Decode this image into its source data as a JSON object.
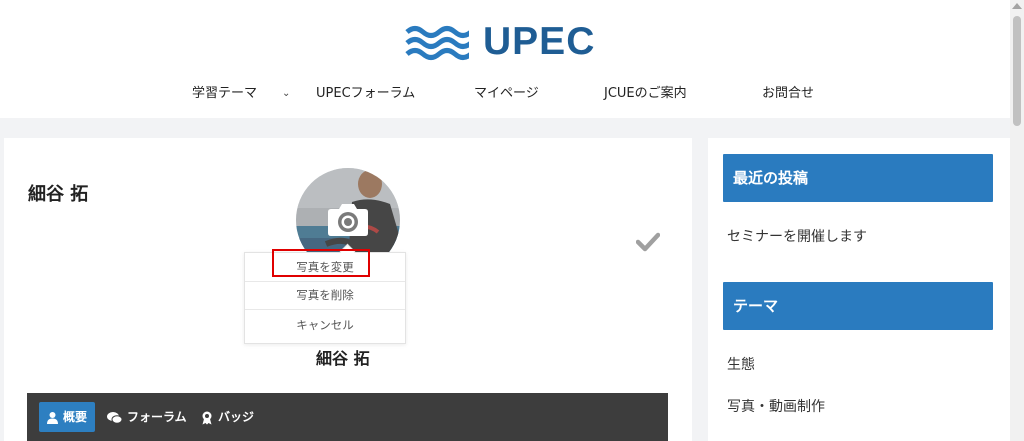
{
  "brand": {
    "name": "UPEC",
    "color": "#1f5d94"
  },
  "nav": {
    "items": [
      {
        "label": "学習テーマ"
      },
      {
        "label": "UPECフォーラム"
      },
      {
        "label": "マイページ"
      },
      {
        "label": "JCUEのご案内"
      },
      {
        "label": "お問合せ"
      }
    ],
    "dropdown_icon": "chevron-down-icon"
  },
  "profile": {
    "name_heading": "細谷 拓",
    "display_name": "細谷 拓",
    "avatar_overlay_icon": "camera-icon",
    "save_icon": "checkmark-icon"
  },
  "photo_menu": {
    "change": "写真を変更",
    "delete": "写真を削除",
    "cancel": "キャンセル",
    "highlight_color": "#e00000"
  },
  "tabs": [
    {
      "label": "概要",
      "icon": "user-icon",
      "active": true
    },
    {
      "label": "フォーラム",
      "icon": "comments-icon",
      "active": false
    },
    {
      "label": "バッジ",
      "icon": "badge-icon",
      "active": false
    }
  ],
  "sidebar": {
    "accent": "#2a7bbf",
    "recent_posts": {
      "title": "最近の投稿",
      "items": [
        "セミナーを開催します"
      ]
    },
    "themes": {
      "title": "テーマ",
      "items": [
        "生態",
        "写真・動画制作"
      ]
    }
  }
}
